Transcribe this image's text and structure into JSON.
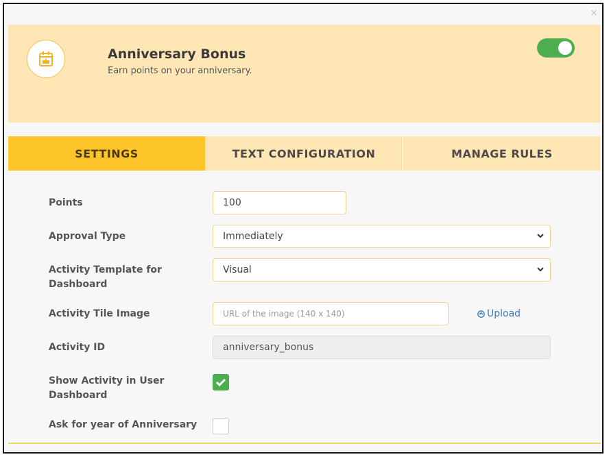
{
  "close_glyph": "×",
  "activity": {
    "title": "Anniversary Bonus",
    "subtitle": "Earn points on your anniversary.",
    "icon": "calendar-cake-icon",
    "enabled": true
  },
  "tabs": [
    {
      "label": "SETTINGS",
      "active": true
    },
    {
      "label": "TEXT CONFIGURATION",
      "active": false
    },
    {
      "label": "MANAGE RULES",
      "active": false
    }
  ],
  "form": {
    "points": {
      "label": "Points",
      "value": "100"
    },
    "approval_type": {
      "label": "Approval Type",
      "value": "Immediately"
    },
    "activity_template": {
      "label": "Activity Template for Dashboard",
      "value": "Visual"
    },
    "tile_image": {
      "label": "Activity Tile Image",
      "placeholder": "URL of the image (140 x 140)",
      "upload_label": "Upload"
    },
    "activity_id": {
      "label": "Activity ID",
      "value": "anniversary_bonus"
    },
    "show_in_dashboard": {
      "label": "Show Activity in User Dashboard",
      "checked": true
    },
    "ask_year": {
      "label": "Ask for year of Anniversary",
      "checked": false
    }
  },
  "colors": {
    "header_bg": "#ffe6b4",
    "active_tab": "#fec52b",
    "toggle_on": "#4cae4f",
    "link": "#3c7bbf"
  }
}
